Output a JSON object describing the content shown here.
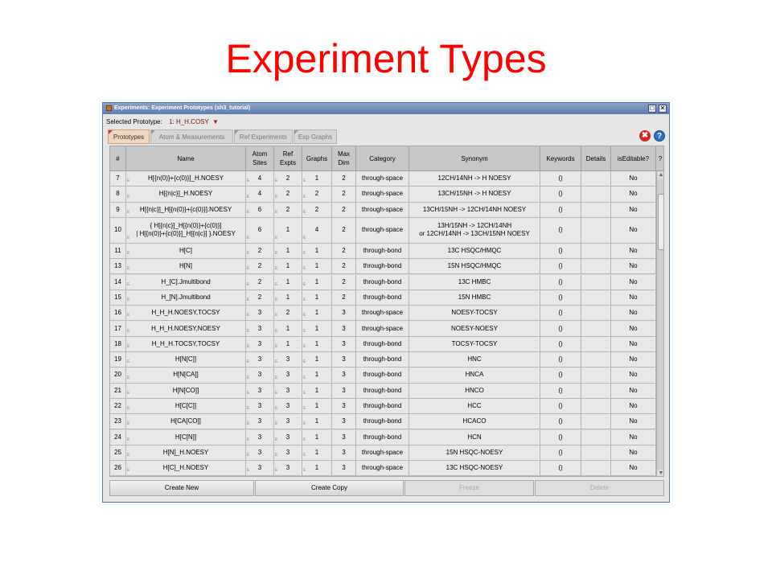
{
  "slide_title": "Experiment Types",
  "window": {
    "title": "Experiments: Experiment Prototypes (sh3_tutorial)",
    "controls": [
      "□",
      "✕"
    ]
  },
  "prototype": {
    "label": "Selected Prototype:",
    "value": "1:  H_H.COSY",
    "dropdown_icon": "chevron-down-icon"
  },
  "tabs": [
    "Prototypes",
    "Atom & Measurements",
    "Ref Experiments",
    "Exp Graphs"
  ],
  "icons": {
    "close": "✖",
    "help": "?"
  },
  "columns": [
    "#",
    "Name",
    "Atom\nSites",
    "Ref\nExpts",
    "Graphs",
    "Max\nDim",
    "Category",
    "Synonym",
    "Keywords",
    "Details",
    "isEditable?",
    "?"
  ],
  "rows": [
    [
      "7",
      "H[{n(0)}+{c(0)}]_H.NOESY",
      "4",
      "2",
      "1",
      "2",
      "through-space",
      "12CH/14NH -> H NOESY",
      "()",
      "",
      "No"
    ],
    [
      "8",
      "H[{n|c}]_H.NOESY",
      "4",
      "2",
      "2",
      "2",
      "through-space",
      "13CH/15NH -> H NOESY",
      "()",
      "",
      "No"
    ],
    [
      "9",
      "H[{n|c}]_H[{n(0)}+{c(0)}].NOESY",
      "6",
      "2",
      "2",
      "2",
      "through-space",
      "13CH/15NH -> 12CH/14NH NOESY",
      "()",
      "",
      "No"
    ],
    [
      "10",
      "{ H[{n|c}]_H[{n(0)}+{c(0)}]\n| H[{n(0)}+{c(0)}]_H[{n|c}] }.NOESY",
      "6",
      "1",
      "4",
      "2",
      "through-space",
      "13H/15NH -> 12CH/14NH\nor 12CH/14NH -> 13CH/15NH NOESY",
      "()",
      "",
      "No"
    ],
    [
      "11",
      "H[C]",
      "2",
      "1",
      "1",
      "2",
      "through-bond",
      "13C HSQC/HMQC",
      "()",
      "",
      "No"
    ],
    [
      "13",
      "H[N]",
      "2",
      "1",
      "1",
      "2",
      "through-bond",
      "15N HSQC/HMQC",
      "()",
      "",
      "No"
    ],
    [
      "14",
      "H_[C].Jmultibond",
      "2",
      "1",
      "1",
      "2",
      "through-bond",
      "13C HMBC",
      "()",
      "",
      "No"
    ],
    [
      "15",
      "H_[N].Jmultibond",
      "2",
      "1",
      "1",
      "2",
      "through-bond",
      "15N HMBC",
      "()",
      "",
      "No"
    ],
    [
      "16",
      "H_H_H.NOESY,TOCSY",
      "3",
      "2",
      "1",
      "3",
      "through-space",
      "NOESY-TOCSY",
      "()",
      "",
      "No"
    ],
    [
      "17",
      "H_H_H.NOESY,NOESY",
      "3",
      "1",
      "1",
      "3",
      "through-space",
      "NOESY-NOESY",
      "()",
      "",
      "No"
    ],
    [
      "18",
      "H_H_H.TOCSY,TOCSY",
      "3",
      "1",
      "1",
      "3",
      "through-bond",
      "TOCSY-TOCSY",
      "()",
      "",
      "No"
    ],
    [
      "19",
      "H[N[C]]",
      "3",
      "3",
      "1",
      "3",
      "through-bond",
      "HNC",
      "()",
      "",
      "No"
    ],
    [
      "20",
      "H[N[CA]]",
      "3",
      "3",
      "1",
      "3",
      "through-bond",
      "HNCA",
      "()",
      "",
      "No"
    ],
    [
      "21",
      "H[N[CO]]",
      "3",
      "3",
      "1",
      "3",
      "through-bond",
      "HNCO",
      "()",
      "",
      "No"
    ],
    [
      "22",
      "H[C[C]]",
      "3",
      "3",
      "1",
      "3",
      "through-bond",
      "HCC",
      "()",
      "",
      "No"
    ],
    [
      "23",
      "H[CA[CO]]",
      "3",
      "3",
      "1",
      "3",
      "through-bond",
      "HCACO",
      "()",
      "",
      "No"
    ],
    [
      "24",
      "H[C[N]]",
      "3",
      "3",
      "1",
      "3",
      "through-bond",
      "HCN",
      "()",
      "",
      "No"
    ],
    [
      "25",
      "H[N]_H.NOESY",
      "3",
      "3",
      "1",
      "3",
      "through-space",
      "15N HSQC-NOESY",
      "()",
      "",
      "No"
    ],
    [
      "26",
      "H[C]_H.NOESY",
      "3",
      "3",
      "1",
      "3",
      "through-space",
      "13C HSQC-NOESY",
      "()",
      "",
      "No"
    ]
  ],
  "buttons": [
    {
      "label": "Create New",
      "enabled": true
    },
    {
      "label": "Create Copy",
      "enabled": true
    },
    {
      "label": "Freeze",
      "enabled": false
    },
    {
      "label": "Delete",
      "enabled": false
    }
  ]
}
